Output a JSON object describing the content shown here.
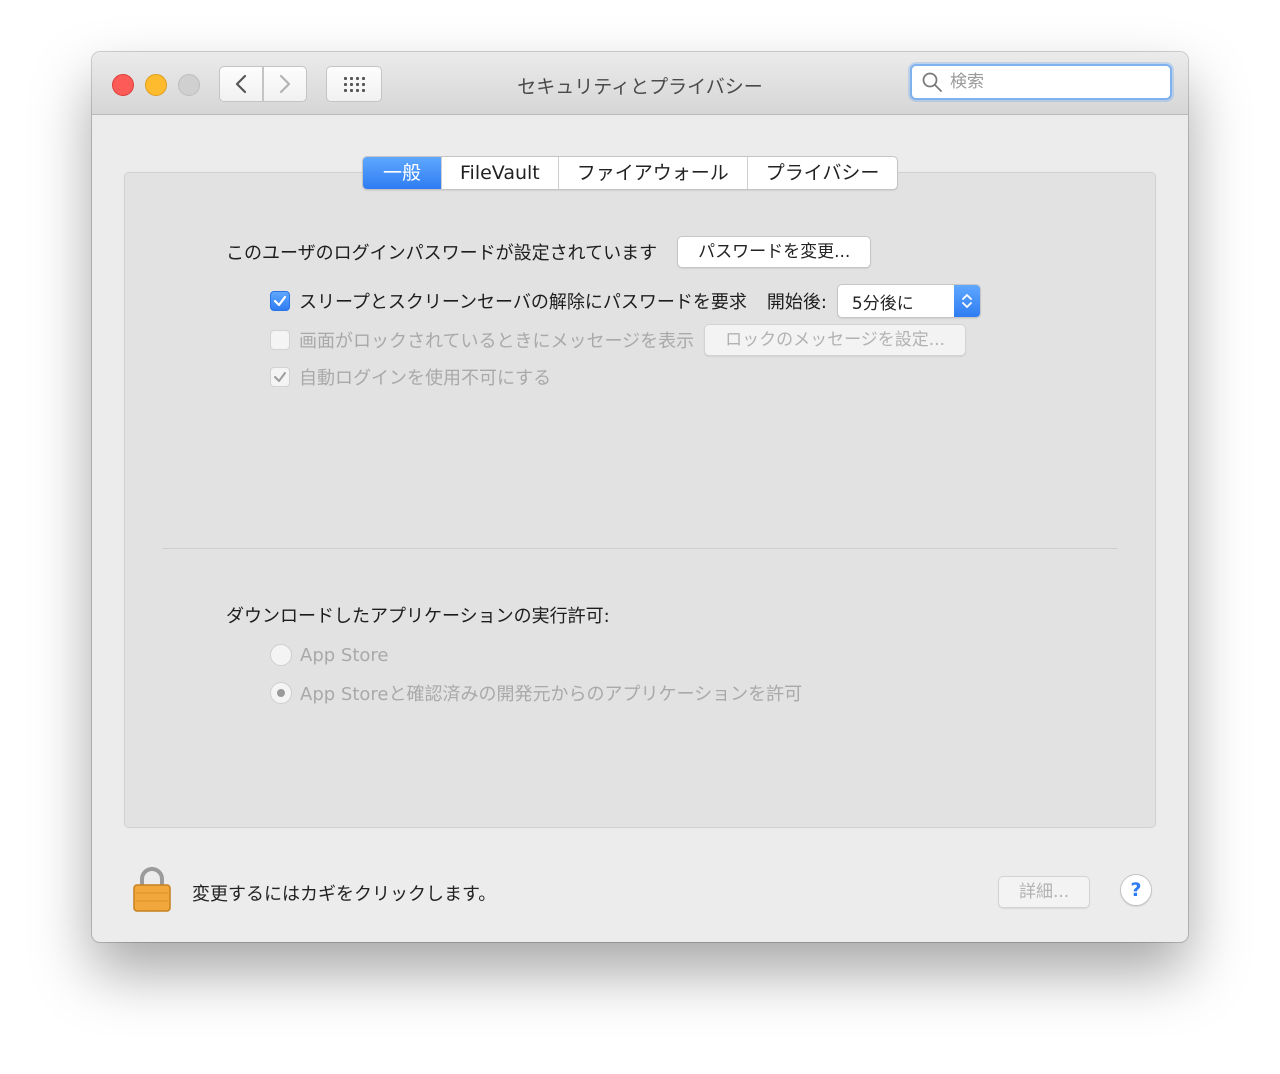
{
  "window": {
    "title": "セキュリティとプライバシー"
  },
  "toolbar": {
    "back_icon": "chevron-left-icon",
    "forward_icon": "chevron-right-icon",
    "show_all_icon": "grid-icon"
  },
  "search": {
    "placeholder": "検索",
    "value": ""
  },
  "tabs": [
    {
      "label": "一般",
      "active": true
    },
    {
      "label": "FileVault",
      "active": false
    },
    {
      "label": "ファイアウォール",
      "active": false
    },
    {
      "label": "プライバシー",
      "active": false
    }
  ],
  "general": {
    "password_label": "このユーザのログインパスワードが設定されています",
    "change_password_button": "パスワードを変更...",
    "require_password": {
      "label": "スリープとスクリーンセーバの解除にパスワードを要求",
      "checked": true,
      "delay_label": "開始後:",
      "delay_value": "5分後に"
    },
    "show_message": {
      "label": "画面がロックされているときにメッセージを表示",
      "checked": false,
      "enabled": false,
      "button": "ロックのメッセージを設定..."
    },
    "disable_auto_login": {
      "label": "自動ログインを使用不可にする",
      "checked": true,
      "enabled": false
    },
    "downloads": {
      "label": "ダウンロードしたアプリケーションの実行許可:",
      "options": [
        {
          "label": "App Store",
          "selected": false
        },
        {
          "label": "App Storeと確認済みの開発元からのアプリケーションを許可",
          "selected": true
        }
      ]
    }
  },
  "footer": {
    "lock_text": "変更するにはカギをクリックします。",
    "details_button": "詳細...",
    "help_label": "?"
  },
  "colors": {
    "accent": "#2f7cf2",
    "close": "#fc5b57",
    "minimize": "#fdbb2d",
    "lock": "#f0a33b"
  }
}
